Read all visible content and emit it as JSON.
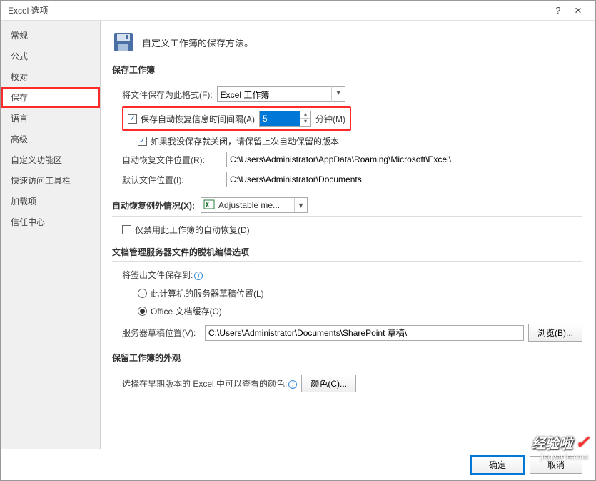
{
  "window": {
    "title": "Excel 选项",
    "help": "?",
    "close": "×"
  },
  "sidebar": {
    "items": [
      {
        "label": "常规"
      },
      {
        "label": "公式"
      },
      {
        "label": "校对"
      },
      {
        "label": "保存"
      },
      {
        "label": "语言"
      },
      {
        "label": "高级"
      },
      {
        "label": "自定义功能区"
      },
      {
        "label": "快速访问工具栏"
      },
      {
        "label": "加载项"
      },
      {
        "label": "信任中心"
      }
    ]
  },
  "header": {
    "desc": "自定义工作簿的保存方法。"
  },
  "section1": {
    "title": "保存工作簿",
    "format_label": "将文件保存为此格式(F):",
    "format_value": "Excel 工作簿",
    "autosave_chk_label": "保存自动恢复信息时间间隔(A)",
    "autosave_minutes": "5",
    "minutes_label": "分钟(M)",
    "keep_last_label": "如果我没保存就关闭，请保留上次自动保留的版本",
    "autorecover_loc_label": "自动恢复文件位置(R):",
    "autorecover_loc_value": "C:\\Users\\Administrator\\AppData\\Roaming\\Microsoft\\Excel\\",
    "default_loc_label": "默认文件位置(I):",
    "default_loc_value": "C:\\Users\\Administrator\\Documents"
  },
  "section2": {
    "title_label": "自动恢复例外情况(X):",
    "combo_value": "Adjustable me...",
    "disable_label": "仅禁用此工作簿的自动恢复(D)"
  },
  "section3": {
    "title": "文档管理服务器文件的脱机编辑选项",
    "checkout_label": "将签出文件保存到:",
    "radio_server": "此计算机的服务器草稿位置(L)",
    "radio_cache": "Office 文档缓存(O)",
    "draft_label": "服务器草稿位置(V):",
    "draft_value": "C:\\Users\\Administrator\\Documents\\SharePoint 草稿\\",
    "browse_btn": "浏览(B)..."
  },
  "section4": {
    "title": "保留工作簿的外观",
    "color_label": "选择在早期版本的 Excel 中可以查看的颜色:",
    "color_btn": "颜色(C)..."
  },
  "footer": {
    "ok": "确定",
    "cancel": "取消"
  },
  "watermark": {
    "text": "经验啦",
    "url": "jingyanla.com"
  }
}
